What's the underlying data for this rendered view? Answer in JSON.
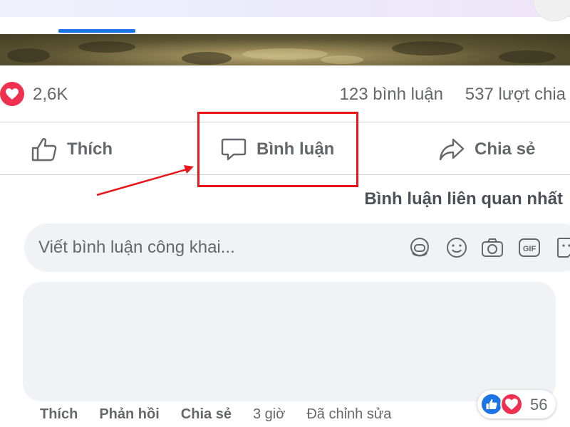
{
  "post": {
    "reaction_count": "2,6K",
    "comments_count": "123 bình luận",
    "shares_count": "537 lượt chia"
  },
  "actions": {
    "like_label": "Thích",
    "comment_label": "Bình luận",
    "share_label": "Chia sẻ"
  },
  "comments": {
    "sort_label": "Bình luận liên quan nhất",
    "input_placeholder": "Viết bình luận công khai...",
    "input_icons": [
      "avatar-sticker-icon",
      "emoji-icon",
      "camera-icon",
      "gif-icon",
      "sticker-icon"
    ],
    "first_comment": {
      "reaction_total": "56",
      "like_label": "Thích",
      "reply_label": "Phản hồi",
      "share_label": "Chia sẻ",
      "time": "3 giờ",
      "edited_label": "Đã chỉnh sửa"
    }
  },
  "colors": {
    "accent_blue": "#1b74e4",
    "love_red": "#f0304f",
    "highlight_red": "#e8151b",
    "text_gray": "#65676b",
    "input_bg": "#f0f2f5"
  }
}
